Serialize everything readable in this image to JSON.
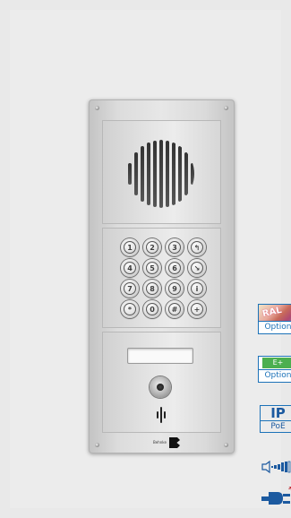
{
  "product": {
    "name": "door intercom panel with keypad",
    "keypad_keys": [
      "1",
      "2",
      "3",
      "↰",
      "4",
      "5",
      "6",
      "↘",
      "7",
      "8",
      "9",
      "i",
      "*",
      "0",
      "#",
      "+"
    ]
  },
  "brand": {
    "text": "Behnke"
  },
  "badges": [
    {
      "name": "ral-option",
      "image_text": "RAL",
      "label": "Option"
    },
    {
      "name": "eplus-option",
      "image_text": "E+",
      "label": "Option"
    },
    {
      "name": "ip-poe",
      "top": "IP",
      "bottom": "PoE"
    }
  ],
  "icons": [
    "volume-icon",
    "power-plug-icon"
  ],
  "colors": {
    "badge_blue": "#1c72b8",
    "plug_blue": "#1c5aa0",
    "asterisk_red": "#c0202a",
    "eplus_green": "#4caf50"
  }
}
